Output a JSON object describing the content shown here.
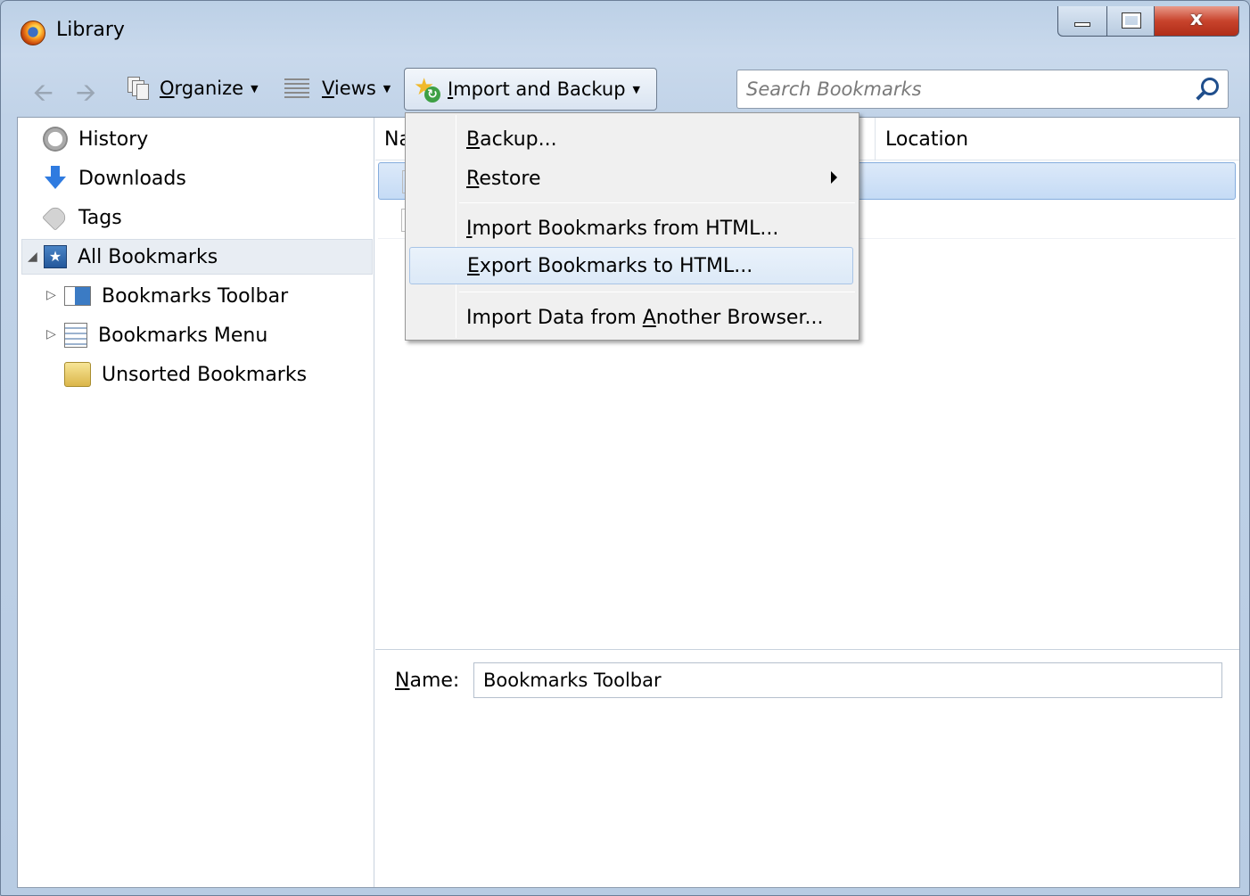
{
  "window": {
    "title": "Library",
    "controls": {
      "minimize": "",
      "maximize": "",
      "close": "x"
    }
  },
  "toolbar": {
    "back_icon": "back-arrow-icon",
    "forward_icon": "forward-arrow-icon",
    "organize": {
      "prefix": "",
      "ul": "O",
      "rest": "rganize"
    },
    "views": {
      "prefix": "",
      "ul": "V",
      "rest": "iews"
    },
    "import_backup": {
      "prefix": "",
      "ul": "I",
      "rest": "mport and Backup"
    },
    "search_placeholder": "Search Bookmarks"
  },
  "sidebar": {
    "items": [
      {
        "label": "History",
        "icon": "history-icon"
      },
      {
        "label": "Downloads",
        "icon": "downloads-icon"
      },
      {
        "label": "Tags",
        "icon": "tag-icon"
      },
      {
        "label": "All Bookmarks",
        "icon": "all-bookmarks-icon",
        "selected": true
      },
      {
        "label": "Bookmarks Toolbar",
        "icon": "bookmarks-toolbar-icon"
      },
      {
        "label": "Bookmarks Menu",
        "icon": "bookmarks-menu-icon"
      },
      {
        "label": "Unsorted Bookmarks",
        "icon": "unsorted-bookmarks-icon"
      }
    ]
  },
  "main": {
    "columns": {
      "name": "Na",
      "location": "Location"
    }
  },
  "details": {
    "name_label_ul": "N",
    "name_label_rest": "ame:",
    "name_value": "Bookmarks Toolbar"
  },
  "menu": {
    "backup": {
      "prefix": "",
      "ul": "B",
      "rest": "ackup..."
    },
    "restore": {
      "prefix": "",
      "ul": "R",
      "rest": "estore"
    },
    "import_html": {
      "prefix": "",
      "ul": "I",
      "rest": "mport Bookmarks from HTML..."
    },
    "export_html": {
      "prefix": "",
      "ul": "E",
      "rest": "xport Bookmarks to HTML..."
    },
    "import_browser": {
      "prefix": "Import Data from ",
      "ul": "A",
      "rest": "nother Browser..."
    }
  },
  "colors": {
    "menu_hover": "#dce9f7",
    "selection": "#c5dbf5",
    "window_frame": "#bcd0e6"
  }
}
